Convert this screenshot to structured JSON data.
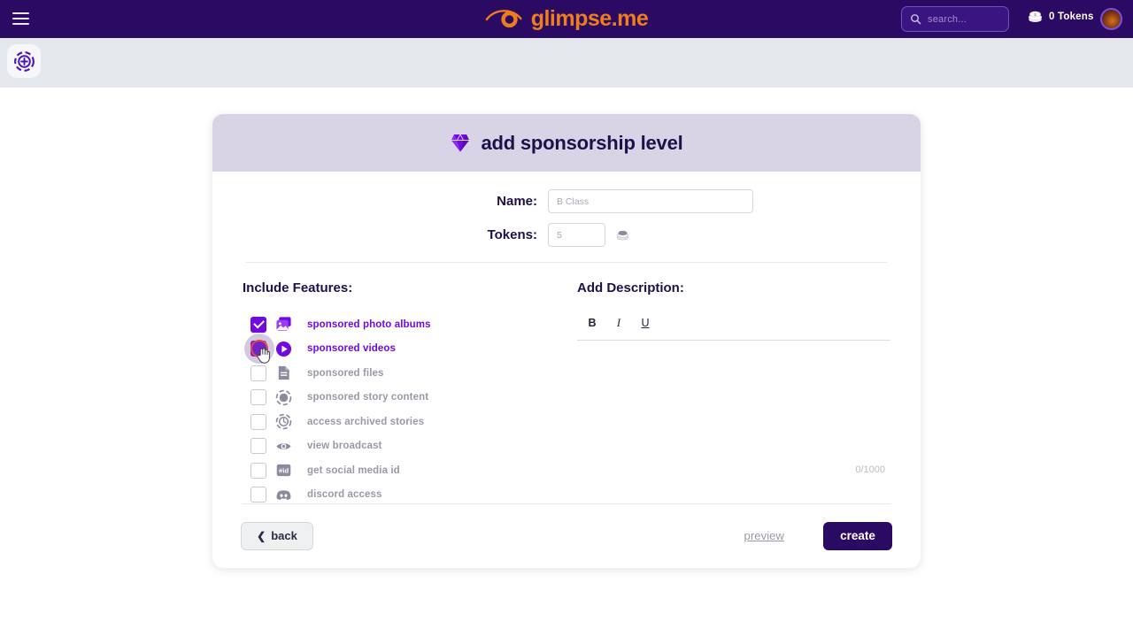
{
  "topbar": {
    "menu_icon": "hamburger-icon",
    "brand_name": "glimpse.me",
    "brand_logo_icon": "eye-logo-icon",
    "search": {
      "placeholder": "search...",
      "value": "",
      "icon": "search-icon"
    },
    "tokens": {
      "label": "0 Tokens",
      "icon": "coin-stack-icon"
    },
    "avatar_icon": "user-avatar",
    "colors": {
      "bar": "#2a0a63",
      "brand": "#ef7d1e",
      "search_bg": "#3a1581"
    }
  },
  "subheader": {
    "add_story_icon": "add-story-icon",
    "background": "#e4e8ed"
  },
  "modal": {
    "header": {
      "icon": "gem-icon",
      "title": "add sponsorship level",
      "background": "#d8d4e6"
    },
    "fields": [
      {
        "label": "Name:",
        "placeholder": "B Class",
        "value": "",
        "name": "name-field"
      },
      {
        "label": "Tokens:",
        "placeholder": "5",
        "value": "",
        "name": "tokens-field",
        "suffix_icon": "coin-icon"
      }
    ],
    "features_section": {
      "title": "Include Features:",
      "items": [
        {
          "label": "sponsored photo albums",
          "checked": true,
          "icon": "photo-album-icon"
        },
        {
          "label": "sponsored videos",
          "checked": false,
          "icon": "play-video-icon",
          "hovered": true
        },
        {
          "label": "sponsored files",
          "checked": false,
          "icon": "file-icon"
        },
        {
          "label": "sponsored story content",
          "checked": false,
          "icon": "story-circle-icon"
        },
        {
          "label": "access archived stories",
          "checked": false,
          "icon": "archive-clock-icon"
        },
        {
          "label": "view broadcast",
          "checked": false,
          "icon": "eye-icon"
        },
        {
          "label": "get social media id",
          "checked": false,
          "icon": "hashtag-id-icon"
        },
        {
          "label": "discord access",
          "checked": false,
          "icon": "discord-icon"
        }
      ]
    },
    "description_section": {
      "title": "Add Description:",
      "toolbar": [
        {
          "label": "B",
          "name": "bold-button"
        },
        {
          "label": "I",
          "name": "italic-button"
        },
        {
          "label": "U",
          "name": "underline-button"
        }
      ],
      "value": "",
      "char_count": "0/1000"
    },
    "footer": {
      "back_label": "back",
      "back_icon": "chevron-left-icon",
      "preview_label": "preview",
      "create_label": "create",
      "create_color": "#2a0a63"
    }
  }
}
